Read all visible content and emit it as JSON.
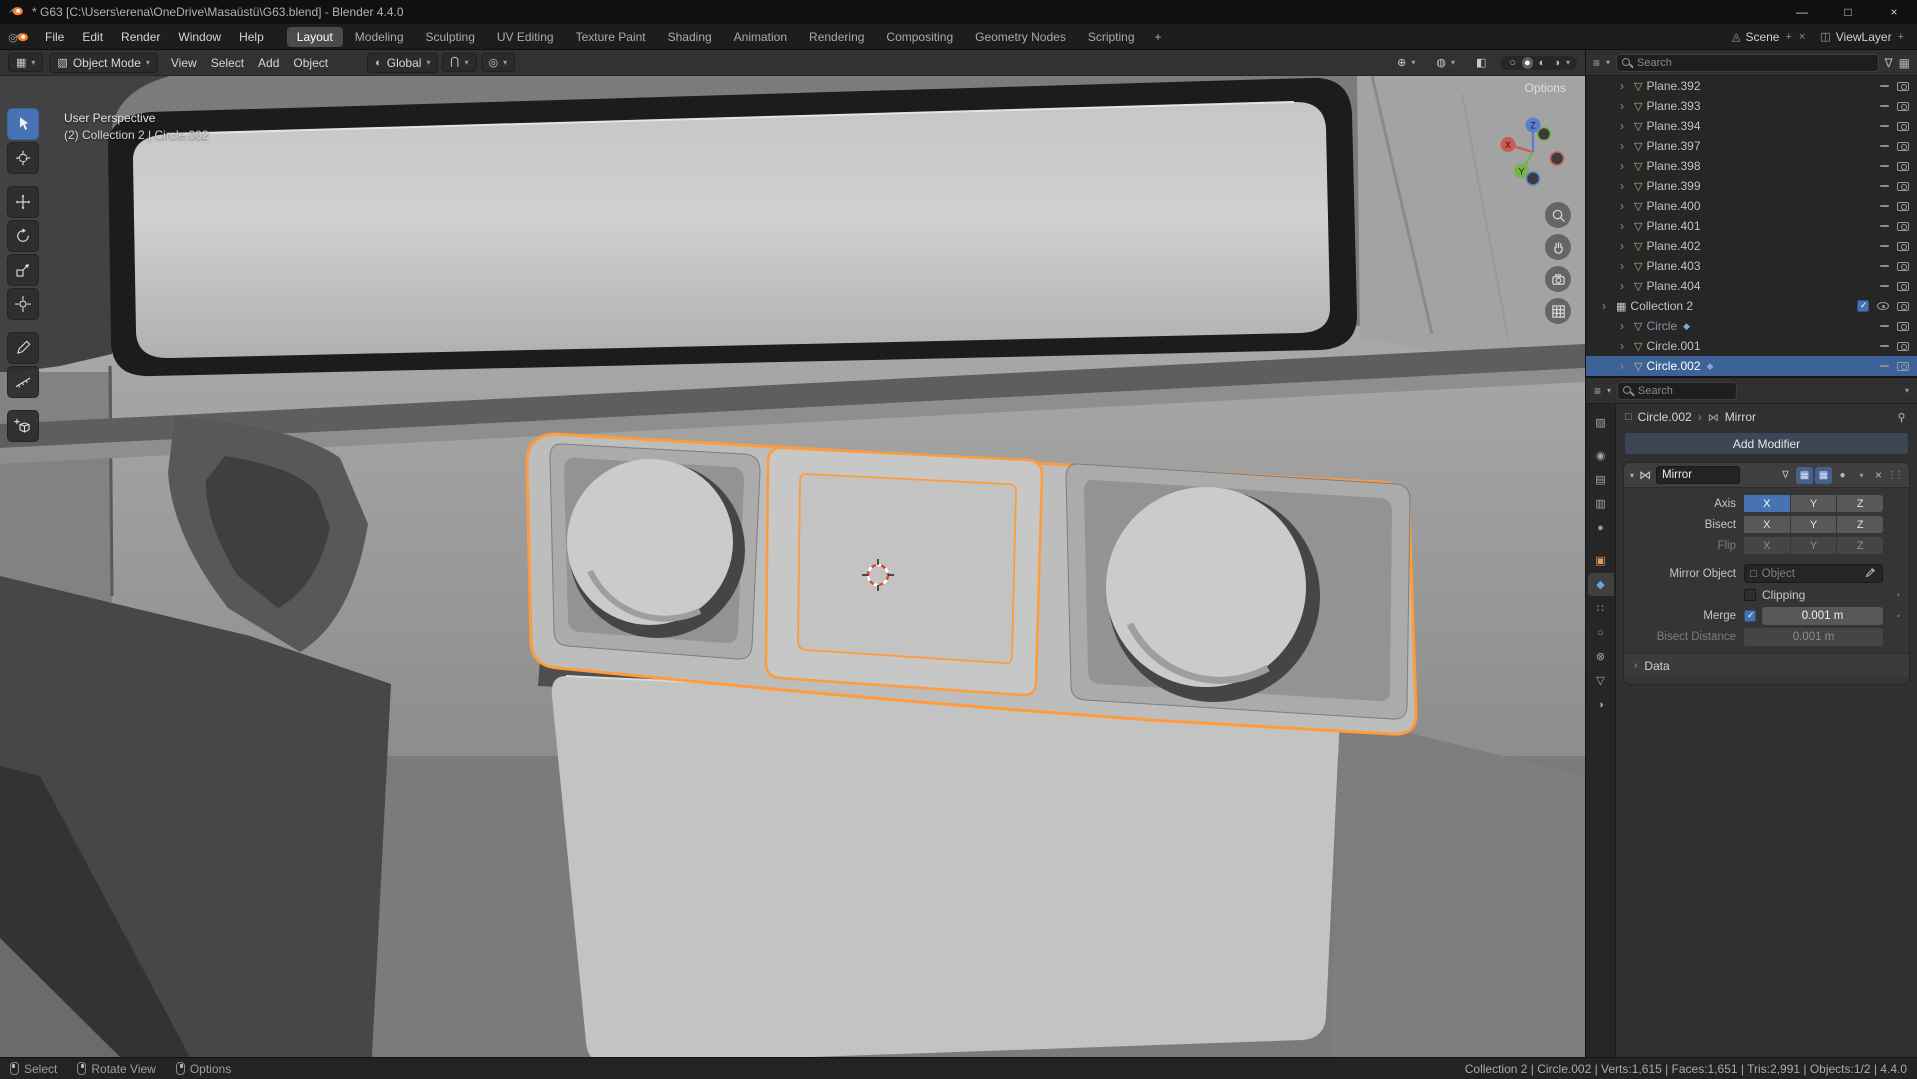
{
  "icons": {
    "chevron": "▾",
    "collapsed": "›",
    "expanded": "▾",
    "editor_grid": "▦",
    "cube": "▧",
    "globe": "◐",
    "magnet": "⋃",
    "prop_edit": "◎",
    "gizmo": "⊕",
    "overlays": "◍",
    "xray": "◧",
    "ball_wireframe": "○",
    "ball_solid": "●",
    "ball_material": "◐",
    "ball_rendered": "◑",
    "mesh": "▽",
    "collection": "▦",
    "wrench": "◆",
    "mirror": "⋈",
    "outliner_editor": "≡",
    "properties_editor": "≡",
    "filter": "∇",
    "new_collection": "▦",
    "breadcrumb_object": "□",
    "breadcrumb_sep": "›",
    "minimize": "—",
    "maximize": "□",
    "close": "×",
    "drag": "⋮⋮",
    "dot": "•",
    "plus": "+",
    "scene": "◬",
    "viewlayer": "◫"
  },
  "colors": {
    "accent": "#4772b3",
    "selection_outline": "#ff9b3d",
    "active_row": "#3c6298",
    "active_tool": "#4772b3"
  },
  "titlebar": {
    "title": "* G63 [C:\\Users\\erena\\OneDrive\\Masaüstü\\G63.blend] - Blender 4.4.0"
  },
  "menubar": {
    "menus": [
      "File",
      "Edit",
      "Render",
      "Window",
      "Help"
    ],
    "workspaces": [
      {
        "label": "Layout",
        "active": true
      },
      {
        "label": "Modeling"
      },
      {
        "label": "Sculpting"
      },
      {
        "label": "UV Editing"
      },
      {
        "label": "Texture Paint"
      },
      {
        "label": "Shading"
      },
      {
        "label": "Animation"
      },
      {
        "label": "Rendering"
      },
      {
        "label": "Compositing"
      },
      {
        "label": "Geometry Nodes"
      },
      {
        "label": "Scripting"
      }
    ],
    "add_tab": "+",
    "scene_widget": {
      "label": "Scene"
    },
    "viewlayer_widget": {
      "label": "ViewLayer"
    }
  },
  "viewport": {
    "header": {
      "mode": "Object Mode",
      "menus": [
        "View",
        "Select",
        "Add",
        "Object"
      ],
      "orientation": "Global"
    },
    "options_label": "Options",
    "overlay": {
      "line1": "User Perspective",
      "line2": "(2) Collection 2 | Circle.002"
    },
    "gizmo_axes": {
      "x": "X",
      "y": "Y",
      "z": "Z"
    }
  },
  "toolbar": {
    "tools": [
      "Tweak Select",
      "Cursor",
      "Move",
      "Rotate",
      "Scale",
      "Transform",
      "Annotate",
      "Measure",
      "Add Cube"
    ]
  },
  "outliner": {
    "search_placeholder": "Search",
    "rows": [
      {
        "name": "Plane.392",
        "is_mesh": true
      },
      {
        "name": "Plane.393",
        "is_mesh": true
      },
      {
        "name": "Plane.394",
        "is_mesh": true
      },
      {
        "name": "Plane.397",
        "is_mesh": true
      },
      {
        "name": "Plane.398",
        "is_mesh": true
      },
      {
        "name": "Plane.399",
        "is_mesh": true
      },
      {
        "name": "Plane.400",
        "is_mesh": true
      },
      {
        "name": "Plane.401",
        "is_mesh": true
      },
      {
        "name": "Plane.402",
        "is_mesh": true
      },
      {
        "name": "Plane.403",
        "is_mesh": true
      },
      {
        "name": "Plane.404",
        "is_mesh": true
      },
      {
        "name": "Collection 2",
        "is_collection": true
      },
      {
        "name": "Circle",
        "is_mesh": true,
        "dimmed": true,
        "wrench": true
      },
      {
        "name": "Circle.001",
        "is_mesh": true
      },
      {
        "name": "Circle.002",
        "is_mesh": true,
        "selected": true,
        "active": true,
        "wrench": true
      }
    ]
  },
  "properties": {
    "search_placeholder": "Search",
    "tabs": [
      {
        "name": "tool",
        "glyph": "▨",
        "gap_after": true
      },
      {
        "name": "render",
        "glyph": "◉"
      },
      {
        "name": "output",
        "glyph": "▤"
      },
      {
        "name": "view-layer",
        "glyph": "▥"
      },
      {
        "name": "scene",
        "glyph": "◎"
      },
      {
        "name": "world",
        "glyph": "●",
        "gap_after": true
      },
      {
        "name": "object",
        "glyph": "▣"
      },
      {
        "name": "modifiers",
        "glyph": "◆",
        "active": true
      },
      {
        "name": "particles",
        "glyph": "∷"
      },
      {
        "name": "physics",
        "glyph": "○"
      },
      {
        "name": "constraints",
        "glyph": "⊗"
      },
      {
        "name": "data",
        "glyph": "▽"
      },
      {
        "name": "material",
        "glyph": "◑"
      }
    ],
    "breadcrumb": {
      "object": "Circle.002",
      "modifier": "Mirror"
    },
    "add_modifier_label": "Add Modifier",
    "modifier": {
      "name_value": "Mirror",
      "axis_label": "Axis",
      "axis_buttons": [
        {
          "label": "X",
          "active": true
        },
        {
          "label": "Y"
        },
        {
          "label": "Z"
        }
      ],
      "bisect_label": "Bisect",
      "bisect_buttons": [
        {
          "label": "X"
        },
        {
          "label": "Y"
        },
        {
          "label": "Z"
        }
      ],
      "flip_label": "Flip",
      "flip_buttons": [
        {
          "label": "X"
        },
        {
          "label": "Y"
        },
        {
          "label": "Z"
        }
      ],
      "mirror_object_label": "Mirror Object",
      "mirror_object_placeholder": "Object",
      "clipping_label": "Clipping",
      "merge_label": "Merge",
      "merge_value": "0.001 m",
      "bisect_distance_label": "Bisect Distance",
      "bisect_distance_value": "0.001 m",
      "data_label": "Data"
    }
  },
  "statusbar": {
    "left": [
      {
        "label": "Select",
        "button": "left"
      },
      {
        "label": "Rotate View",
        "button": "middle"
      },
      {
        "label": "Options",
        "button": "right"
      }
    ],
    "right": "Collection 2 | Circle.002 | Verts:1,615 | Faces:1,651 | Tris:2,991 | Objects:1/2 | 4.4.0"
  }
}
